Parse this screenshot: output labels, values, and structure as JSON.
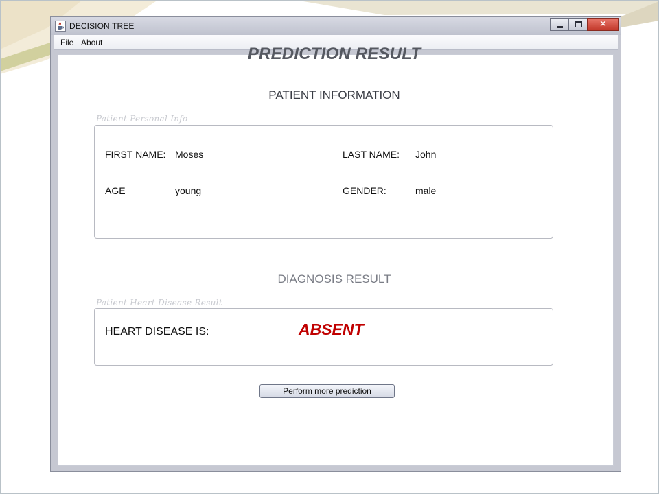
{
  "window": {
    "title": "DECISION TREE",
    "app_icon": "java-cup-icon",
    "controls": {
      "minimize": "minimize-icon",
      "maximize": "maximize-icon",
      "close": "close-icon",
      "close_glyph": "✕"
    }
  },
  "menu": {
    "items": [
      "File",
      "About"
    ]
  },
  "page": {
    "title": "PREDICTION RESULT",
    "patient_section": "PATIENT INFORMATION",
    "diagnosis_section": "DIAGNOSIS RESULT"
  },
  "personal": {
    "caption": "Patient Personal Info",
    "first_name_label": "FIRST NAME:",
    "first_name": "Moses",
    "last_name_label": "LAST NAME:",
    "last_name": "John",
    "age_label": "AGE",
    "age": "young",
    "gender_label": "GENDER:",
    "gender": "male"
  },
  "diagnosis": {
    "caption": "Patient Heart Disease Result",
    "label": "HEART DISEASE IS:",
    "value": "ABSENT"
  },
  "actions": {
    "more_label": "Perform more prediction"
  },
  "colors": {
    "result": "#c00000",
    "title": "#555860",
    "close_button": "#c2382a"
  }
}
